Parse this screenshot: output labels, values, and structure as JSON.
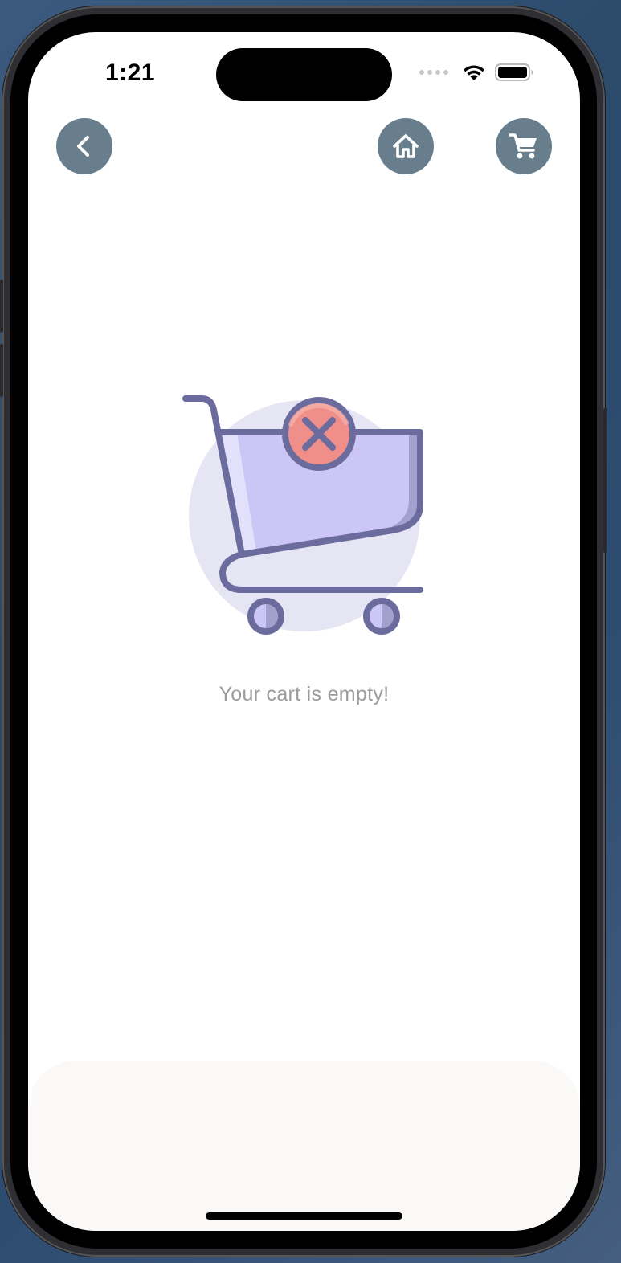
{
  "status_bar": {
    "time": "1:21"
  },
  "nav": {
    "back_icon": "chevron-left-icon",
    "home_icon": "home-icon",
    "cart_icon": "shopping-cart-icon"
  },
  "empty_state": {
    "illustration_icon": "empty-cart-icon",
    "message": "Your cart is empty!"
  },
  "colors": {
    "nav_button": "#687e8d",
    "illustration_stroke": "#6b6b9e",
    "illustration_fill": "#cbc6f5",
    "illustration_bg": "#e6e5f3",
    "remove_badge": "#f08f8a",
    "message_text": "#9b9b9b",
    "bottom_sheet": "#faf9f7"
  }
}
